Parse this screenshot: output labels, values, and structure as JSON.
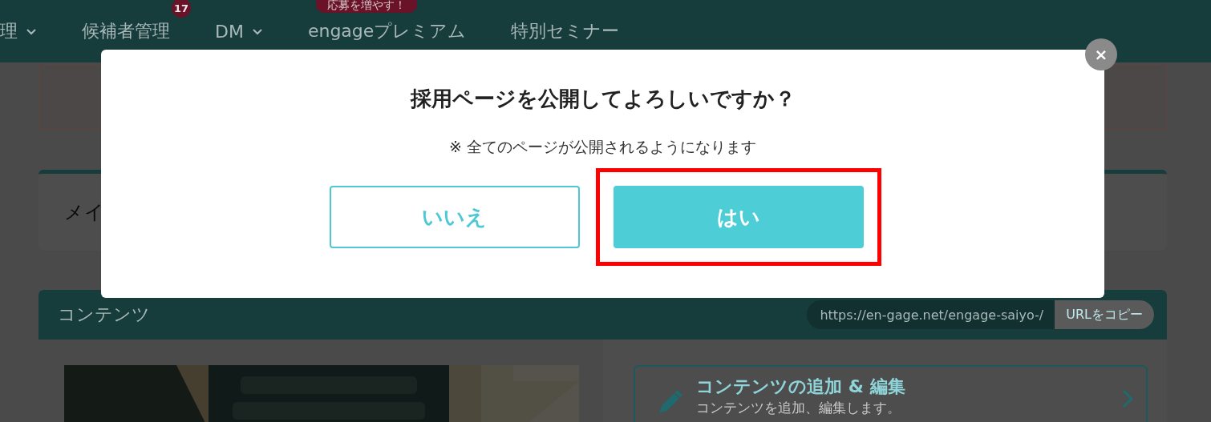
{
  "nav": {
    "items": [
      {
        "label": "理",
        "dropdown": true
      },
      {
        "label": "候補者管理",
        "dropdown": false,
        "badge": "17"
      },
      {
        "label": "DM",
        "dropdown": true
      },
      {
        "label": "engageプレミアム",
        "dropdown": false,
        "promo": "応募を増やす！"
      },
      {
        "label": "特別セミナー",
        "dropdown": false
      }
    ]
  },
  "main_card": {
    "title": "メイ"
  },
  "contents": {
    "title": "コンテンツ",
    "url": "https://en-gage.net/engage-saiyo-/",
    "copy_button": "URLをコピー",
    "action": {
      "title": "コンテンツの追加 & 編集",
      "description": "コンテンツを追加、編集します。"
    }
  },
  "dialog": {
    "close": "×",
    "title": "採用ページを公開してよろしいですか？",
    "note": "※ 全てのページが公開されるようになります",
    "buttons": [
      {
        "label": "いいえ",
        "kind": "secondary",
        "highlighted": false
      },
      {
        "label": "はい",
        "kind": "primary",
        "highlighted": true
      }
    ]
  }
}
